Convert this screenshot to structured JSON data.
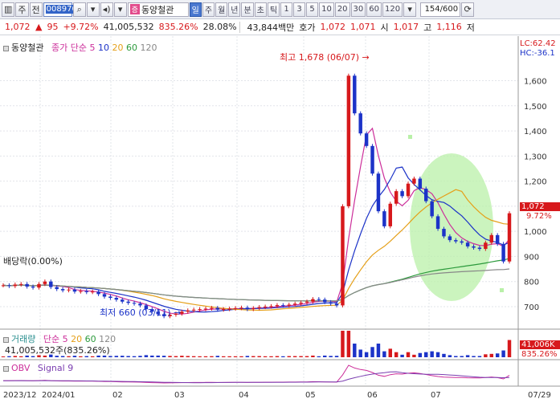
{
  "toolbar": {
    "buttons": [
      "주",
      "전"
    ],
    "code": "008970",
    "stock_badge": "증",
    "stock_name": "동양철관",
    "periods": [
      "일",
      "주",
      "월",
      "년",
      "분",
      "초",
      "틱"
    ],
    "active_period": "일",
    "intervals": [
      "1",
      "3",
      "5",
      "10",
      "20",
      "30",
      "60",
      "120"
    ],
    "counter": "154/600"
  },
  "quote": {
    "price": "1,072",
    "change": "95",
    "change_pct": "+9.72%",
    "volume": "41,005,532",
    "volume_ratio": "835.26%",
    "turnover": "28.08%",
    "amount": "43,844백만",
    "hoga_label": "호가",
    "ask": "1,072",
    "bid": "1,071",
    "open_label": "시",
    "open": "1,017",
    "high_label": "고",
    "high": "1,116",
    "low_label": "저"
  },
  "price_panel": {
    "legend_name": "동양철관",
    "legend_ma": "종가 단순",
    "ma_periods": [
      "5",
      "10",
      "20",
      "60",
      "120"
    ],
    "ma_colors": [
      "#cc2e9a",
      "#1c33c8",
      "#e5a01a",
      "#2c9a3c",
      "#888888"
    ],
    "lc_label": "LC:62.42",
    "hc_label": "HC:-36.1",
    "high_annotation": "최고 1,678 (06/07)",
    "low_annotation": "최저 660 (03/11)",
    "dividend_annotation": "배당락(0.00%)",
    "current_price_tag": "1,072",
    "current_pct_tag": "9.72%"
  },
  "volume_panel": {
    "legend_name": "거래량",
    "legend_ma": "단순",
    "ma_periods": [
      "5",
      "20",
      "60",
      "120"
    ],
    "volume_text": "41,005,532주(835.26%)",
    "tag_value": "41,006K",
    "tag_pct": "835.26%"
  },
  "obv_panel": {
    "legend": "OBV",
    "signal": "Signal 9"
  },
  "x_axis": [
    "2023/12",
    "2024/01",
    "02",
    "03",
    "04",
    "05",
    "06",
    "07",
    "07/29"
  ],
  "chart_data": {
    "type": "line",
    "ylim": [
      620,
      1720
    ],
    "y_ticks": [
      700,
      800,
      900,
      1000,
      1100,
      1200,
      1300,
      1400,
      1500,
      1600
    ],
    "series": [
      {
        "name": "동양철관",
        "values": [
          785,
          782,
          788,
          790,
          780,
          776,
          790,
          800,
          778,
          770,
          765,
          768,
          760,
          762,
          758,
          760,
          750,
          740,
          735,
          728,
          720,
          715,
          712,
          705,
          690,
          680,
          670,
          662,
          668,
          672,
          680,
          685,
          688,
          690,
          692,
          695,
          688,
          690,
          692,
          694,
          696,
          690,
          694,
          698,
          700,
          702,
          706,
          704,
          708,
          712,
          716,
          720,
          730,
          728,
          718,
          712,
          705,
          1100,
          1620,
          1470,
          1390,
          1340,
          1230,
          1080,
          1020,
          1110,
          1160,
          1140,
          1190,
          1210,
          1170,
          1120,
          1060,
          1010,
          980,
          965,
          960,
          955,
          940,
          935,
          930,
          955,
          985,
          950,
          880,
          1072
        ]
      }
    ]
  }
}
